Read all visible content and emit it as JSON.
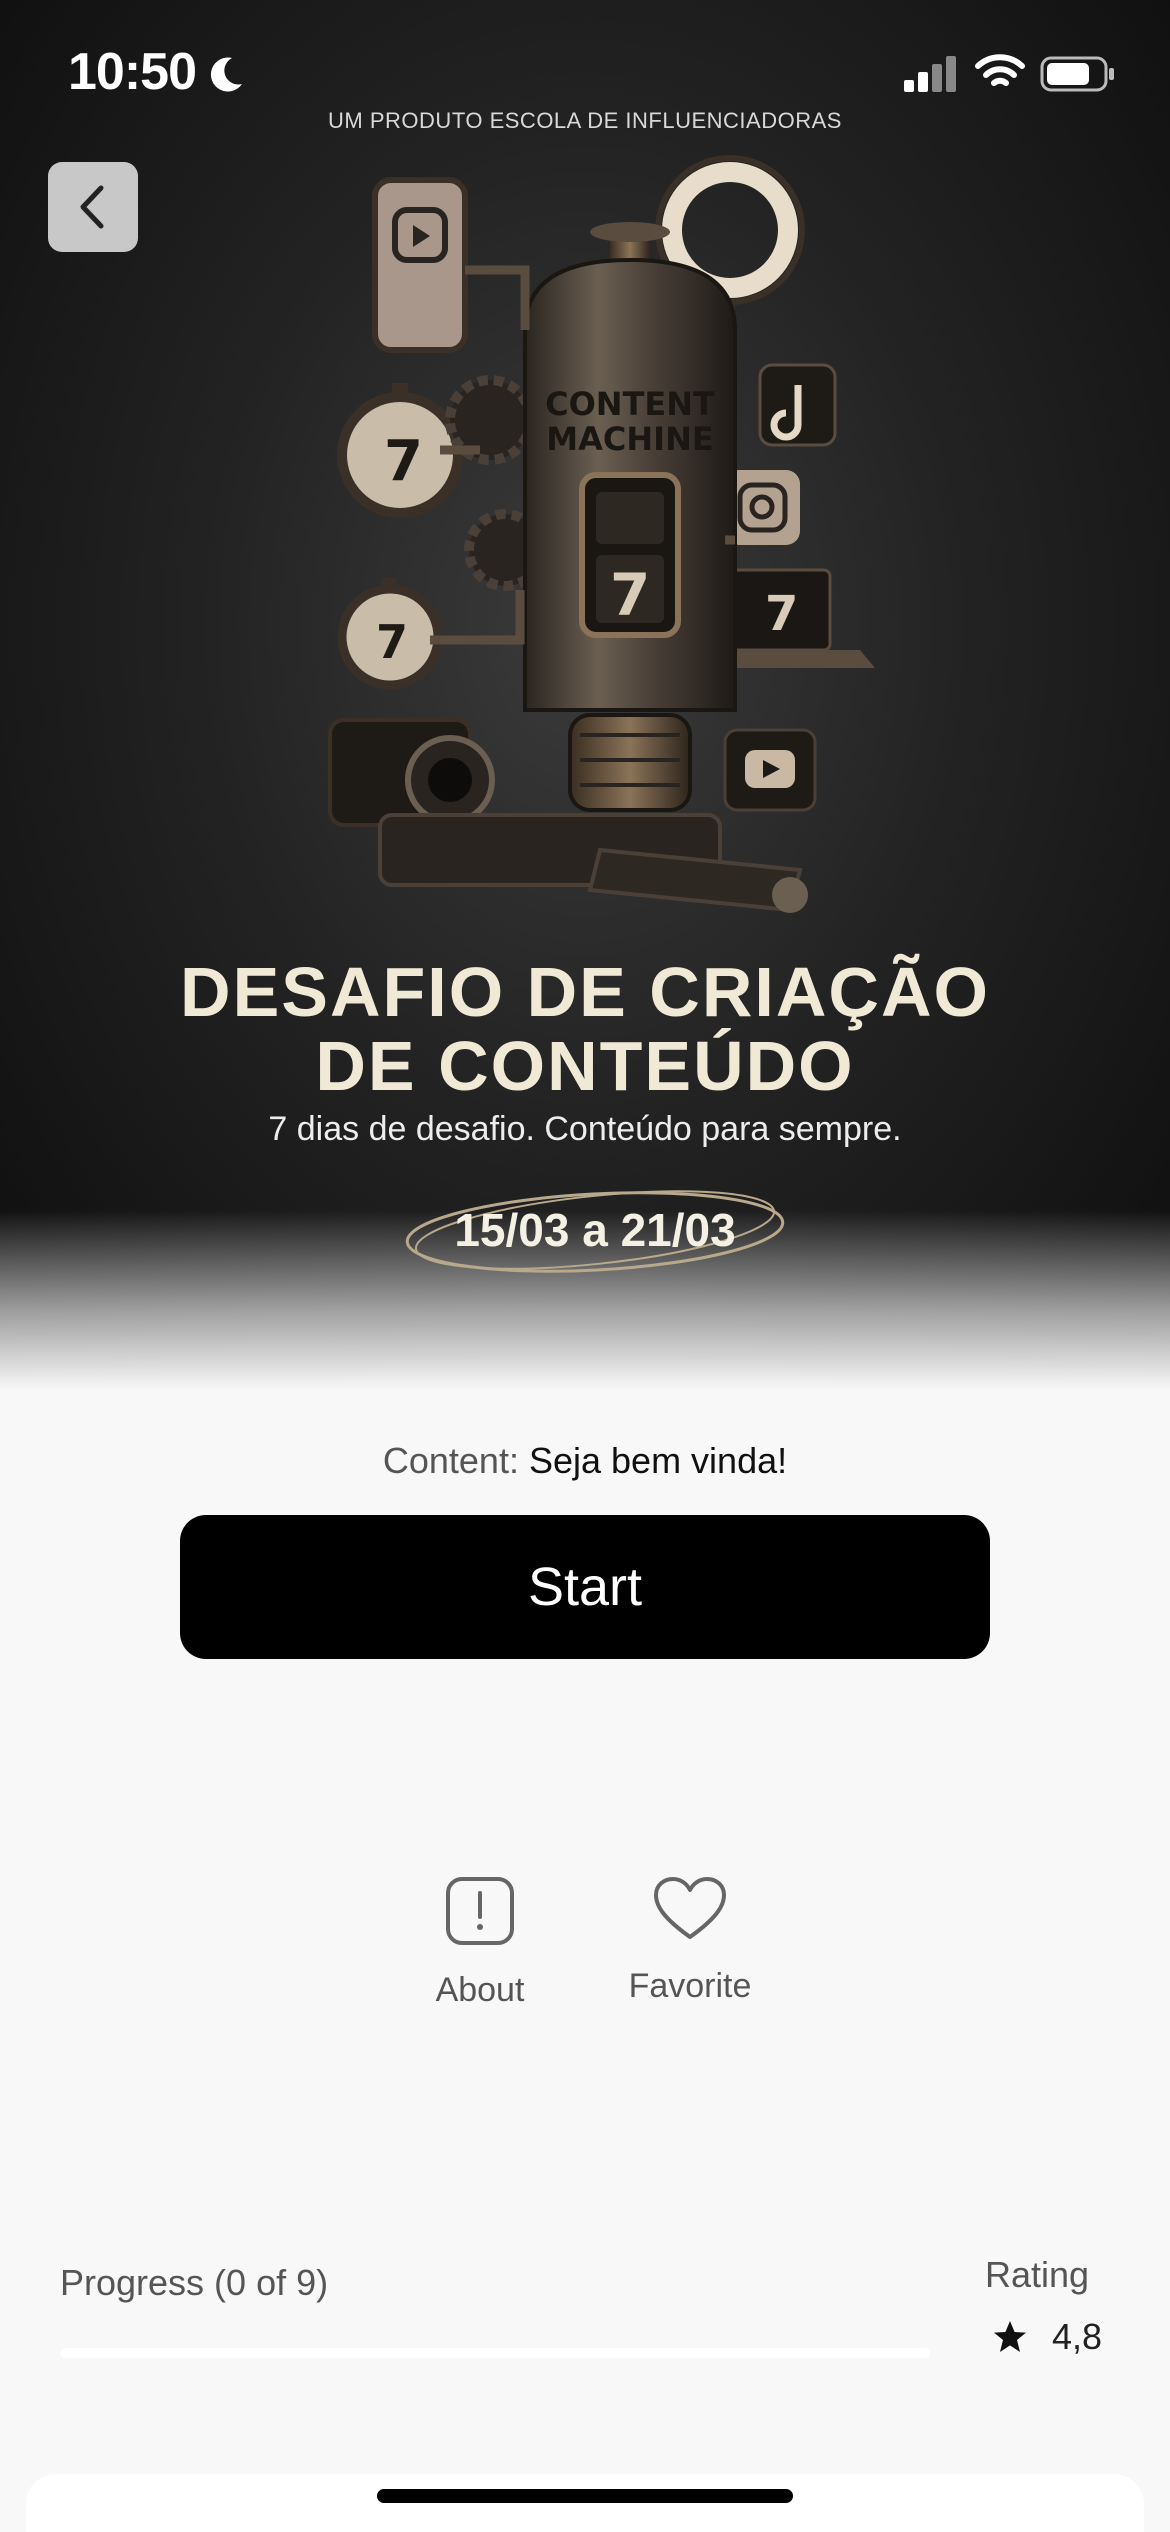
{
  "status_bar": {
    "time": "10:50"
  },
  "hero": {
    "brand_line": "UM PRODUTO ESCOLA DE INFLUENCIADORAS",
    "machine_label": "CONTENT MACHINE",
    "machine_counter": "7",
    "title_line1": "DESAFIO DE CRIAÇÃO",
    "title_line2": "DE CONTEÚDO",
    "subtitle": "7 dias de desafio. Conteúdo para sempre.",
    "dates": "15/03 a 21/03"
  },
  "content": {
    "label": "Content:",
    "value": "Seja bem vinda!"
  },
  "start_button_label": "Start",
  "actions": {
    "about_label": "About",
    "favorite_label": "Favorite"
  },
  "progress": {
    "label": "Progress (0 of 9)",
    "completed": 0,
    "total": 9
  },
  "rating": {
    "label": "Rating",
    "value": "4,8"
  },
  "colors": {
    "hero_title": "#efe9d6",
    "button_bg": "#000000",
    "page_bg": "#f8f8f8"
  }
}
